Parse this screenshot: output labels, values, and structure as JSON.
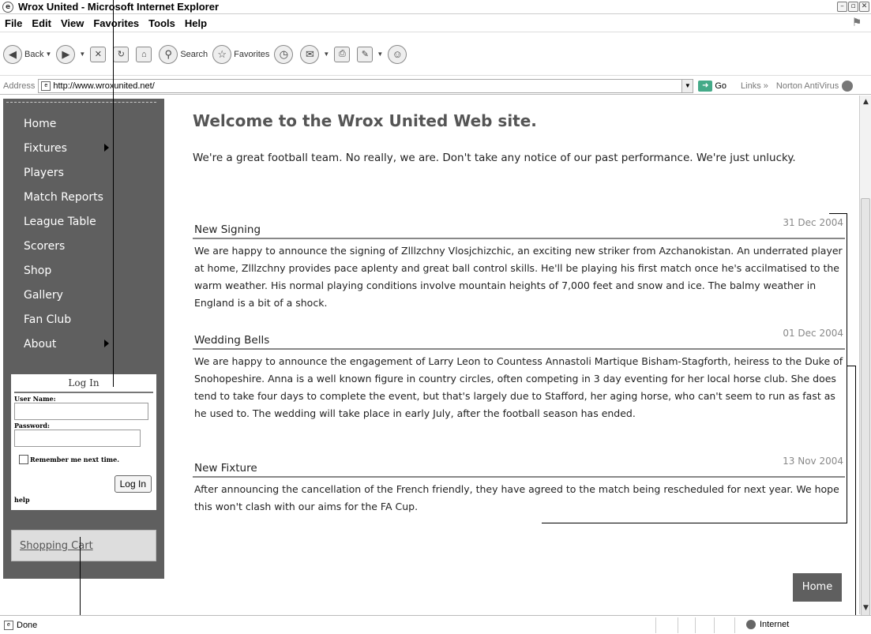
{
  "window": {
    "title": "Wrox United - Microsoft Internet Explorer"
  },
  "menu": [
    "File",
    "Edit",
    "View",
    "Favorites",
    "Tools",
    "Help"
  ],
  "toolbar": {
    "back": "Back",
    "search": "Search",
    "favorites": "Favorites"
  },
  "address": {
    "label": "Address",
    "url": "http://www.wroxunited.net/",
    "go": "Go",
    "links": "Links",
    "norton": "Norton AntiVirus"
  },
  "sidebar": {
    "nav": [
      {
        "label": "Home",
        "has_submenu": false
      },
      {
        "label": "Fixtures",
        "has_submenu": true
      },
      {
        "label": "Players",
        "has_submenu": false
      },
      {
        "label": "Match Reports",
        "has_submenu": false
      },
      {
        "label": "League Table",
        "has_submenu": false
      },
      {
        "label": "Scorers",
        "has_submenu": false
      },
      {
        "label": "Shop",
        "has_submenu": false
      },
      {
        "label": "Gallery",
        "has_submenu": false
      },
      {
        "label": "Fan Club",
        "has_submenu": false
      },
      {
        "label": "About",
        "has_submenu": true
      }
    ],
    "login": {
      "title": "Log In",
      "username_label": "User Name:",
      "password_label": "Password:",
      "remember_label": "Remember me next time.",
      "button": "Log In",
      "help": "help"
    },
    "cart": "Shopping Cart"
  },
  "main": {
    "heading": "Welcome to the Wrox United Web site.",
    "intro": "We're a great football team. No really, we are. Don't take any notice of our past performance. We're just unlucky.",
    "news": [
      {
        "title": "New Signing",
        "date": "31 Dec 2004",
        "body": "We are happy to announce the signing of Zlllzchny Vlosjchizchic, an exciting new striker from Azchanokistan. An underrated player at home, Zlllzchny provides pace aplenty and great ball control skills. He'll be playing his first match once he's accilmatised to the warm weather. His normal playing conditions involve mountain heights of 7,000 feet and snow and ice. The balmy weather in England is a bit of a shock."
      },
      {
        "title": "Wedding Bells",
        "date": "01 Dec 2004",
        "body": "We are happy to announce the engagement of Larry Leon to Countess Annastoli Martique Bisham-Stagforth, heiress to the Duke of Snohopeshire. Anna is a well known figure in country circles, often competing in 3 day eventing for her local horse club. She does tend to take four days to complete the event, but that's largely due to Stafford, her aging horse, who can't seem to run as fast as he used to. The wedding will take place in early July, after the football season has ended."
      },
      {
        "title": "New Fixture",
        "date": "13 Nov 2004",
        "body": "After announcing the cancellation of the French friendly, they have agreed to the match being rescheduled for next year. We hope this won't clash with our aims for the FA Cup."
      }
    ],
    "home_button": "Home"
  },
  "status": {
    "text": "Done",
    "zone": "Internet"
  },
  "colors": {
    "sidebar": "#5f5f5f",
    "heading": "#555555",
    "date": "#888888"
  }
}
